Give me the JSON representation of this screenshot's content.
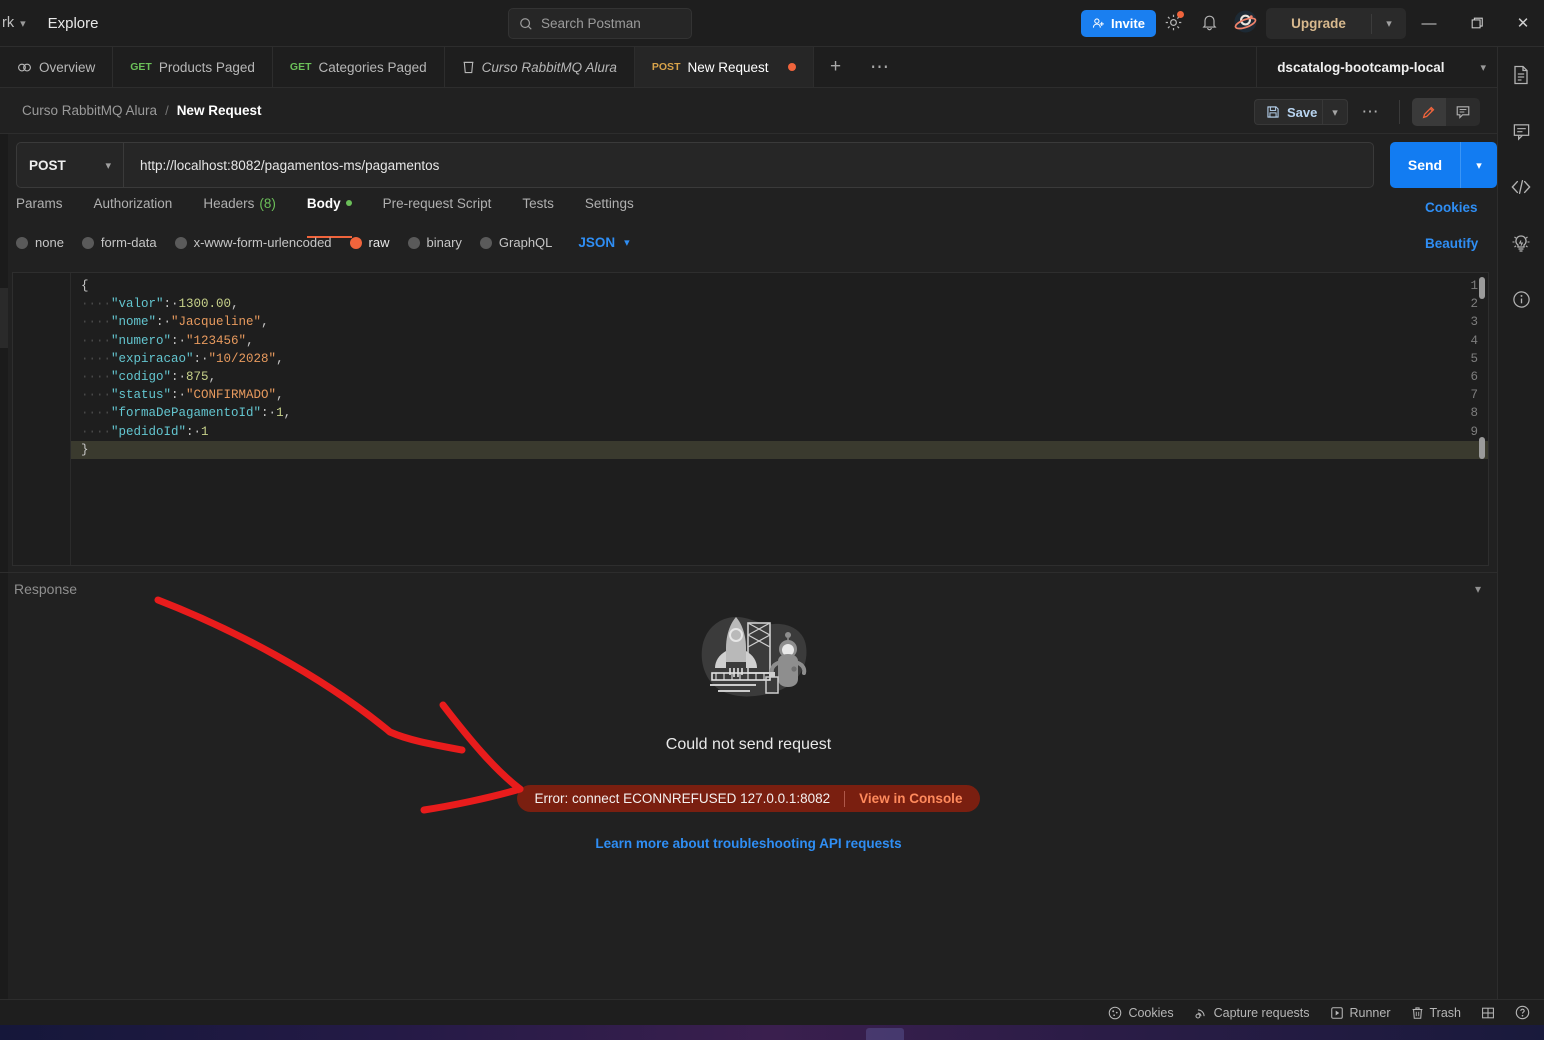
{
  "topbar": {
    "workspace_label": "rk",
    "explore_label": "Explore",
    "search_placeholder": "Search Postman",
    "invite_label": "Invite",
    "upgrade_label": "Upgrade",
    "icons": {
      "search": "search-icon",
      "settings": "gear-icon",
      "notifications": "bell-icon",
      "account": "planet-avatar-icon",
      "minimize": "minimize-icon",
      "maximize": "maximize-icon",
      "close": "close-icon"
    }
  },
  "tabs": [
    {
      "label": "Overview",
      "method": "",
      "icon": "overview-icon",
      "active": false,
      "dirty": false
    },
    {
      "label": "Products Paged",
      "method": "GET",
      "icon": "",
      "active": false,
      "dirty": false
    },
    {
      "label": "Categories Paged",
      "method": "GET",
      "icon": "",
      "active": false,
      "dirty": false
    },
    {
      "label": "Curso RabbitMQ Alura",
      "method": "",
      "icon": "collection-icon",
      "active": false,
      "dirty": false
    },
    {
      "label": "New Request",
      "method": "POST",
      "icon": "",
      "active": true,
      "dirty": true
    }
  ],
  "tabbar": {
    "new_tab_label": "+",
    "more_label": "⋯",
    "workspace_name": "dscatalog-bootcamp-local"
  },
  "breadcrumb": {
    "parent": "Curso RabbitMQ Alura",
    "separator": "/",
    "current": "New Request",
    "save_label": "Save",
    "more_label": "⋯"
  },
  "request": {
    "method": "POST",
    "url": "http://localhost:8082/pagamentos-ms/pagamentos",
    "send_label": "Send",
    "tabs": [
      {
        "label": "Params",
        "active": false,
        "count": "",
        "dot": false
      },
      {
        "label": "Authorization",
        "active": false,
        "count": "",
        "dot": false
      },
      {
        "label": "Headers",
        "active": false,
        "count": "(8)",
        "dot": false
      },
      {
        "label": "Body",
        "active": true,
        "count": "",
        "dot": true
      },
      {
        "label": "Pre-request Script",
        "active": false,
        "count": "",
        "dot": false
      },
      {
        "label": "Tests",
        "active": false,
        "count": "",
        "dot": false
      },
      {
        "label": "Settings",
        "active": false,
        "count": "",
        "dot": false
      }
    ],
    "cookies_label": "Cookies",
    "beautify_label": "Beautify",
    "body_types": [
      {
        "label": "none",
        "selected": false
      },
      {
        "label": "form-data",
        "selected": false
      },
      {
        "label": "x-www-form-urlencoded",
        "selected": false
      },
      {
        "label": "raw",
        "selected": true
      },
      {
        "label": "binary",
        "selected": false
      },
      {
        "label": "GraphQL",
        "selected": false
      }
    ],
    "raw_format": "JSON"
  },
  "editor": {
    "lines": [
      {
        "n": "1",
        "tokens": [
          {
            "t": "{",
            "c": "p"
          }
        ]
      },
      {
        "n": "2",
        "tokens": [
          {
            "t": "····",
            "c": "ind"
          },
          {
            "t": "\"valor\"",
            "c": "k"
          },
          {
            "t": ":·",
            "c": "p"
          },
          {
            "t": "1300.00",
            "c": "n"
          },
          {
            "t": ",",
            "c": "p"
          }
        ]
      },
      {
        "n": "3",
        "tokens": [
          {
            "t": "····",
            "c": "ind"
          },
          {
            "t": "\"nome\"",
            "c": "k"
          },
          {
            "t": ":·",
            "c": "p"
          },
          {
            "t": "\"Jacqueline\"",
            "c": "s"
          },
          {
            "t": ",",
            "c": "p"
          }
        ]
      },
      {
        "n": "4",
        "tokens": [
          {
            "t": "····",
            "c": "ind"
          },
          {
            "t": "\"numero\"",
            "c": "k"
          },
          {
            "t": ":·",
            "c": "p"
          },
          {
            "t": "\"123456\"",
            "c": "s"
          },
          {
            "t": ",",
            "c": "p"
          }
        ]
      },
      {
        "n": "5",
        "tokens": [
          {
            "t": "····",
            "c": "ind"
          },
          {
            "t": "\"expiracao\"",
            "c": "k"
          },
          {
            "t": ":·",
            "c": "p"
          },
          {
            "t": "\"10/2028\"",
            "c": "s"
          },
          {
            "t": ",",
            "c": "p"
          }
        ]
      },
      {
        "n": "6",
        "tokens": [
          {
            "t": "····",
            "c": "ind"
          },
          {
            "t": "\"codigo\"",
            "c": "k"
          },
          {
            "t": ":·",
            "c": "p"
          },
          {
            "t": "875",
            "c": "n"
          },
          {
            "t": ",",
            "c": "p"
          }
        ]
      },
      {
        "n": "7",
        "tokens": [
          {
            "t": "····",
            "c": "ind"
          },
          {
            "t": "\"status\"",
            "c": "k"
          },
          {
            "t": ":·",
            "c": "p"
          },
          {
            "t": "\"CONFIRMADO\"",
            "c": "s"
          },
          {
            "t": ",",
            "c": "p"
          }
        ]
      },
      {
        "n": "8",
        "tokens": [
          {
            "t": "····",
            "c": "ind"
          },
          {
            "t": "\"formaDePagamentoId\"",
            "c": "k"
          },
          {
            "t": ":·",
            "c": "p"
          },
          {
            "t": "1",
            "c": "n"
          },
          {
            "t": ",",
            "c": "p"
          }
        ]
      },
      {
        "n": "9",
        "tokens": [
          {
            "t": "····",
            "c": "ind"
          },
          {
            "t": "\"pedidoId\"",
            "c": "k"
          },
          {
            "t": ":·",
            "c": "p"
          },
          {
            "t": "1",
            "c": "n"
          }
        ]
      },
      {
        "n": "10",
        "tokens": [
          {
            "t": "}",
            "c": "p"
          }
        ],
        "highlight": true
      }
    ]
  },
  "response": {
    "label": "Response",
    "error_title": "Could not send request",
    "error_message": "Error: connect ECONNREFUSED 127.0.0.1:8082",
    "view_console_label": "View in Console",
    "learn_more_label": "Learn more about troubleshooting API requests",
    "illustration": "rocket-astronaut-illustration"
  },
  "right_rail": [
    {
      "icon": "document-icon",
      "name": "documentation"
    },
    {
      "icon": "comment-icon",
      "name": "comments"
    },
    {
      "icon": "code-icon",
      "name": "code-snippet"
    },
    {
      "icon": "lightbulb-icon",
      "name": "postbot"
    },
    {
      "icon": "info-icon",
      "name": "info"
    }
  ],
  "statusbar": [
    {
      "label": "Cookies",
      "icon": "cookie-icon"
    },
    {
      "label": "Capture requests",
      "icon": "satellite-icon"
    },
    {
      "label": "Runner",
      "icon": "runner-icon"
    },
    {
      "label": "Trash",
      "icon": "trash-icon"
    },
    {
      "label": "",
      "icon": "layout-icon"
    },
    {
      "label": "",
      "icon": "help-icon"
    }
  ],
  "colors": {
    "accent_orange": "#f0643c",
    "link_blue": "#2f8ef4",
    "send_blue": "#127cf2",
    "get_green": "#6bbf59",
    "post_yellow": "#d8a34a",
    "error_bg": "#7a1f10",
    "annotation_red": "#e81c1c"
  },
  "annotation": {
    "shape": "hand-drawn-arrow",
    "color": "#e81c1c"
  }
}
